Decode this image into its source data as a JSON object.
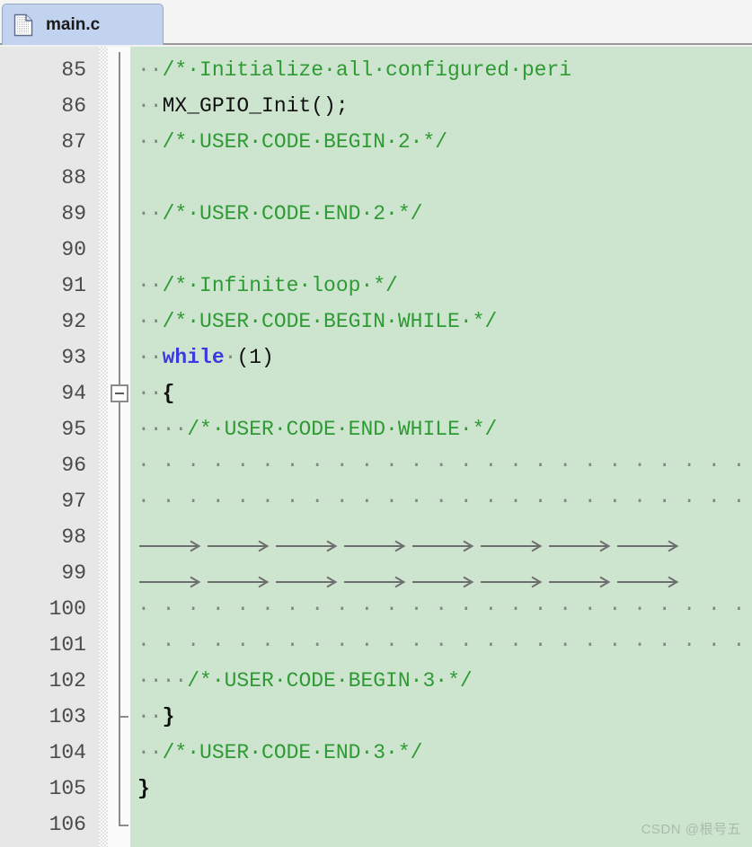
{
  "window": {
    "app": "code-editor",
    "colors": {
      "code_background": "#cde5cf",
      "gutter_background": "#e7e7e7",
      "tab_active_background": "#c1d3ee",
      "comment_green": "#2e9a33",
      "keyword_blue": "#3a3ae0",
      "whitespace_dot": "#7d8a7d",
      "fold_guide": "#8b8b8b",
      "watermark": "#a9bca9"
    }
  },
  "tabs": [
    {
      "label": "main.c",
      "icon": "file-document-icon",
      "active": true
    }
  ],
  "editor": {
    "first_line": 85,
    "last_line": 106,
    "show_whitespace": true,
    "whitespace_space_glyph": "·",
    "whitespace_tab_glyph": "⟶",
    "lines": [
      {
        "number": "85",
        "indent_dots": 2,
        "text": "/*·Initialize·all·configured·peri",
        "type": "comment",
        "clipped": true,
        "fold": "line"
      },
      {
        "number": "86",
        "indent_dots": 2,
        "text": "MX_GPIO_Init();",
        "type": "code",
        "fold": "line"
      },
      {
        "number": "87",
        "indent_dots": 2,
        "text": "/*·USER·CODE·BEGIN·2·*/",
        "type": "comment",
        "fold": "line"
      },
      {
        "number": "88",
        "indent_dots": 0,
        "text": "",
        "type": "blank",
        "fold": "line"
      },
      {
        "number": "89",
        "indent_dots": 2,
        "text": "/*·USER·CODE·END·2·*/",
        "type": "comment",
        "fold": "line"
      },
      {
        "number": "90",
        "indent_dots": 0,
        "text": "",
        "type": "blank",
        "fold": "line"
      },
      {
        "number": "91",
        "indent_dots": 2,
        "text": "/*·Infinite·loop·*/",
        "type": "comment",
        "fold": "line"
      },
      {
        "number": "92",
        "indent_dots": 2,
        "text": "/*·USER·CODE·BEGIN·WHILE·*/",
        "type": "comment",
        "fold": "line"
      },
      {
        "number": "93",
        "indent_dots": 2,
        "keyword": "while",
        "text": "·(1)",
        "type": "keyword-line",
        "fold": "line"
      },
      {
        "number": "94",
        "indent_dots": 2,
        "text": "{",
        "type": "brace",
        "fold": "box-minus"
      },
      {
        "number": "95",
        "indent_dots": 4,
        "text": "/*·USER·CODE·END·WHILE·*/",
        "type": "comment",
        "fold": "line"
      },
      {
        "number": "96",
        "indent_dots": 32,
        "text": "",
        "type": "dots-only",
        "fold": "line"
      },
      {
        "number": "97",
        "indent_dots": 32,
        "text": "",
        "type": "dots-only",
        "fold": "line"
      },
      {
        "number": "98",
        "tabs": 8,
        "text": "",
        "type": "tabs-only",
        "fold": "line"
      },
      {
        "number": "99",
        "tabs": 8,
        "text": "",
        "type": "tabs-only",
        "fold": "line"
      },
      {
        "number": "100",
        "indent_dots": 32,
        "text": "",
        "type": "dots-only",
        "fold": "line"
      },
      {
        "number": "101",
        "indent_dots": 32,
        "text": "",
        "type": "dots-only",
        "fold": "line"
      },
      {
        "number": "102",
        "indent_dots": 4,
        "text": "/*·USER·CODE·BEGIN·3·*/",
        "type": "comment",
        "fold": "line"
      },
      {
        "number": "103",
        "indent_dots": 2,
        "text": "}",
        "type": "brace",
        "fold": "tick"
      },
      {
        "number": "104",
        "indent_dots": 2,
        "text": "/*·USER·CODE·END·3·*/",
        "type": "comment",
        "fold": "line"
      },
      {
        "number": "105",
        "indent_dots": 0,
        "text": "}",
        "type": "brace",
        "fold": "line"
      },
      {
        "number": "106",
        "indent_dots": 0,
        "text": "",
        "type": "blank",
        "fold": "corner"
      }
    ]
  },
  "watermark": {
    "text": "CSDN @根号五"
  }
}
